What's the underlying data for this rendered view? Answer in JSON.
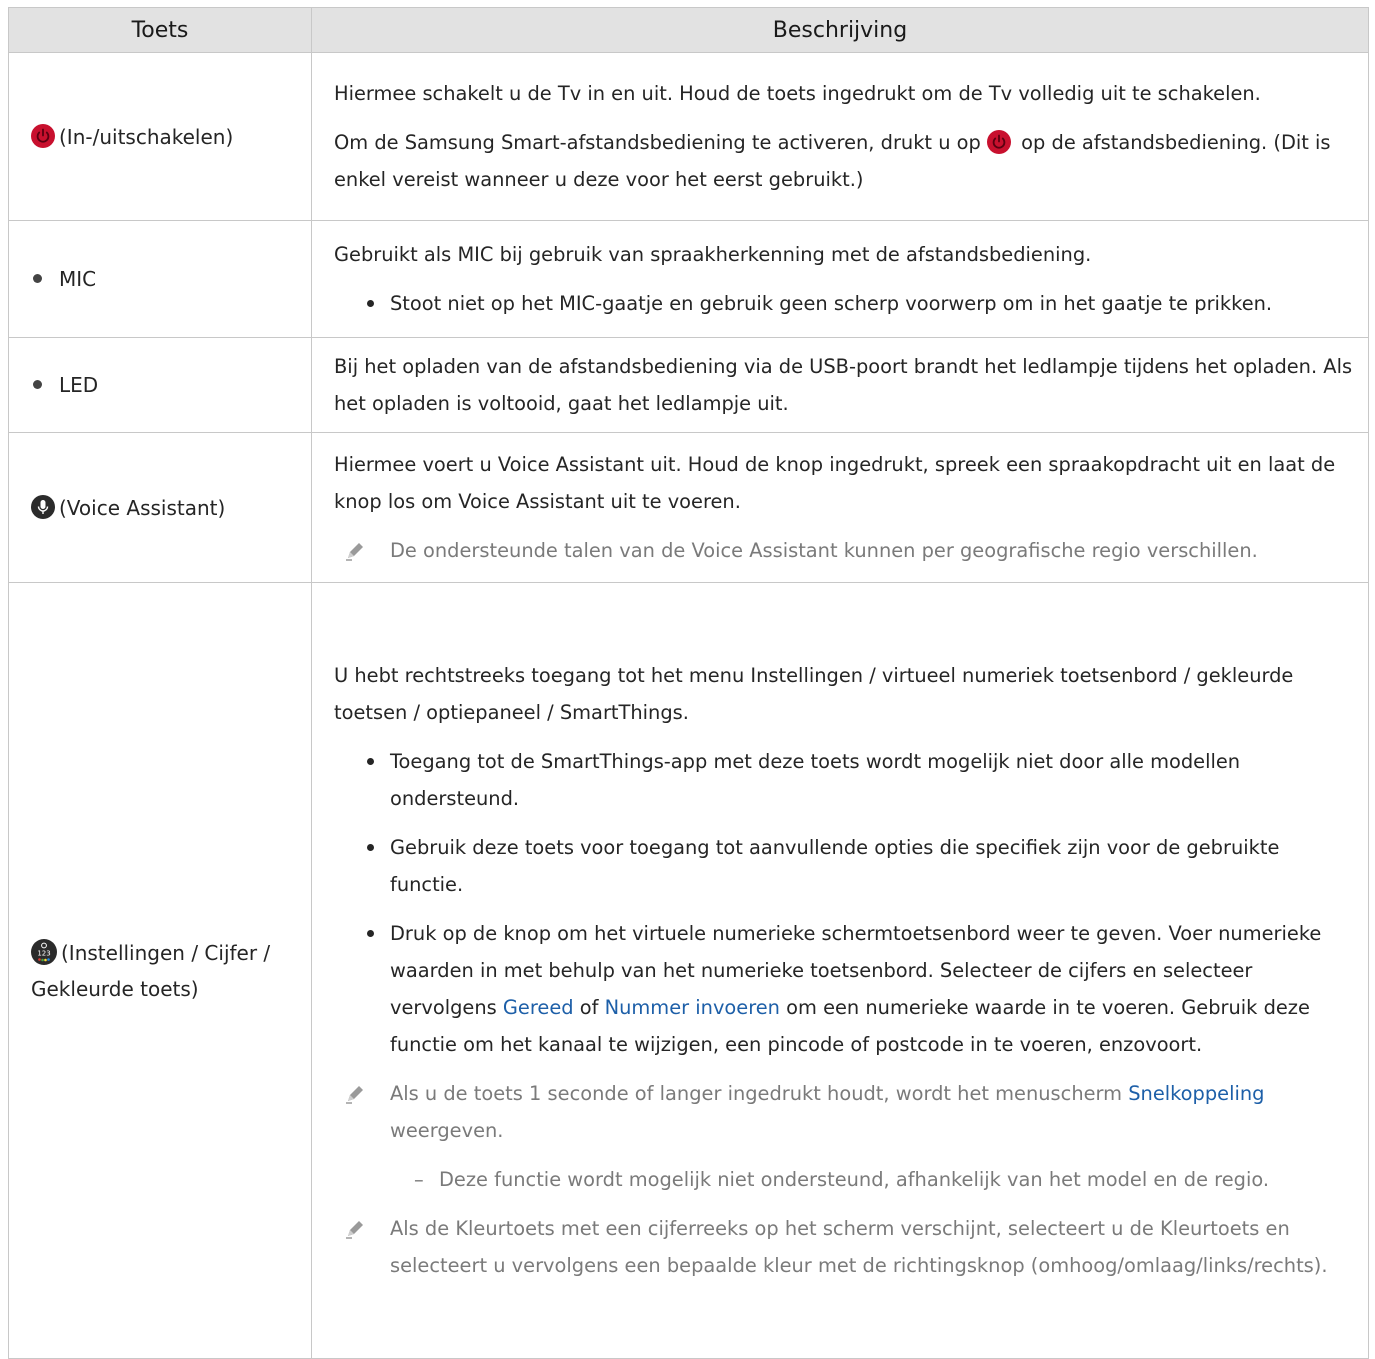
{
  "table": {
    "headers": {
      "key": "Toets",
      "description": "Beschrijving"
    },
    "rows": [
      {
        "key": "(In-/uitschakelen)",
        "icon": "power-icon",
        "desc1": "Hiermee schakelt u de Tv in en uit. Houd de toets ingedrukt om de Tv volledig uit te schakelen.",
        "desc2_pre": "Om de Samsung Smart-afstandsbediening te activeren, drukt u op",
        "desc2_post": "op de afstandsbediening. (Dit is enkel vereist wanneer u deze voor het eerst gebruikt.)"
      },
      {
        "key": "MIC",
        "desc1": "Gebruikt als MIC bij gebruik van spraakherkenning met de afstandsbediening.",
        "bullet1": "Stoot niet op het MIC-gaatje en gebruik geen scherp voorwerp om in het gaatje te prikken."
      },
      {
        "key": "LED",
        "desc1": "Bij het opladen van de afstandsbediening via de USB-poort brandt het ledlampje tijdens het opladen. Als het opladen is voltooid, gaat het ledlampje uit."
      },
      {
        "key": "(Voice Assistant)",
        "icon": "microphone-icon",
        "desc1": "Hiermee voert u Voice Assistant uit. Houd de knop ingedrukt, spreek een spraakopdracht uit en laat de knop los om Voice Assistant uit te voeren.",
        "note1": "De ondersteunde talen van de Voice Assistant kunnen per geografische regio verschillen."
      },
      {
        "key": "(Instellingen / Cijfer / Gekleurde toets)",
        "icon": "settings-number-color-icon",
        "icon_text": "123",
        "desc1": "U hebt rechtstreeks toegang tot het menu Instellingen / virtueel numeriek toetsenbord / gekleurde toetsen / optiepaneel / SmartThings.",
        "bullet1": "Toegang tot de SmartThings-app met deze toets wordt mogelijk niet door alle modellen ondersteund.",
        "bullet2": "Gebruik deze toets voor toegang tot aanvullende opties die specifiek zijn voor de gebruikte functie.",
        "bullet3_a": "Druk op de knop om het virtuele numerieke schermtoetsenbord weer te geven. Voer numerieke waarden in met behulp van het numerieke toetsenbord. Selecteer de cijfers en selecteer vervolgens",
        "bullet3_link1": "Gereed",
        "bullet3_b": "of",
        "bullet3_link2": "Nummer invoeren",
        "bullet3_c": "om een numerieke waarde in te voeren. Gebruik deze functie om het kanaal te wijzigen, een pincode of postcode in te voeren, enzovoort.",
        "note1_a": "Als u de toets 1 seconde of langer ingedrukt houdt, wordt het menuscherm",
        "note1_link": "Snelkoppeling",
        "note1_b": "weergeven.",
        "dash1": "Deze functie wordt mogelijk niet ondersteund, afhankelijk van het model en de regio.",
        "note2": "Als de Kleurtoets met een cijferreeks op het scherm verschijnt, selecteert u de Kleurtoets en selecteert u vervolgens een bepaalde kleur met de richtingsknop (omhoog/omlaag/links/rechts)."
      }
    ]
  },
  "symbols": {
    "dash": "–"
  },
  "colors": {
    "header_bg": "#e2e2e2",
    "link": "#1d5fa8",
    "power_red": "#c8102e",
    "note_gray": "#7a7a7a"
  }
}
